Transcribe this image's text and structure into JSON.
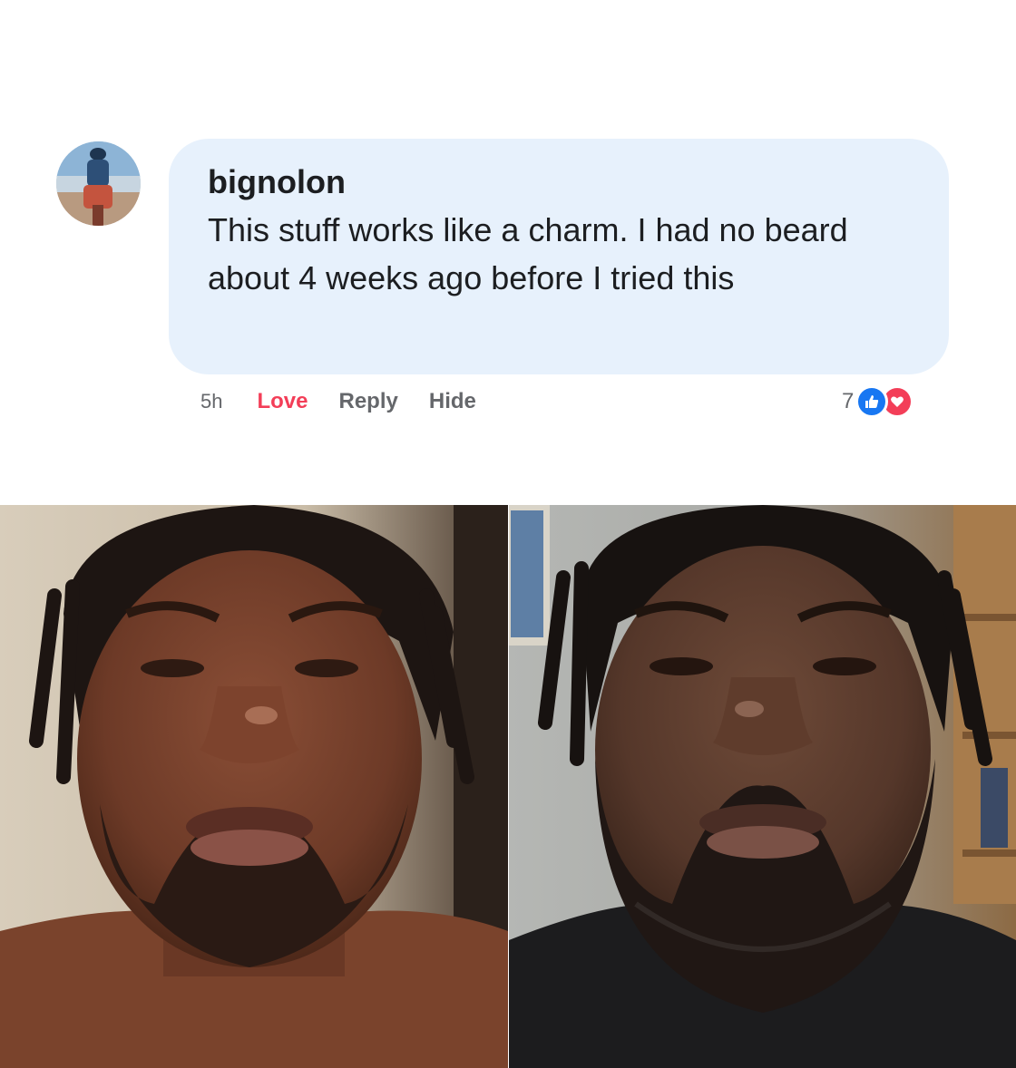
{
  "comment": {
    "author": "bignolon",
    "text": "This stuff works like a charm. I had no beard about 4 weeks ago before I tried this",
    "time": "5h",
    "actions": {
      "love": "Love",
      "reply": "Reply",
      "hide": "Hide"
    },
    "reaction_count": "7",
    "reactions": [
      "like-icon",
      "love-icon"
    ]
  },
  "colors": {
    "bubble": "#e7f1fc",
    "love_action": "#f33e58",
    "like_reaction": "#1877f2",
    "love_reaction": "#f33e58"
  },
  "photos": {
    "before": "before-photo",
    "after": "after-photo"
  }
}
